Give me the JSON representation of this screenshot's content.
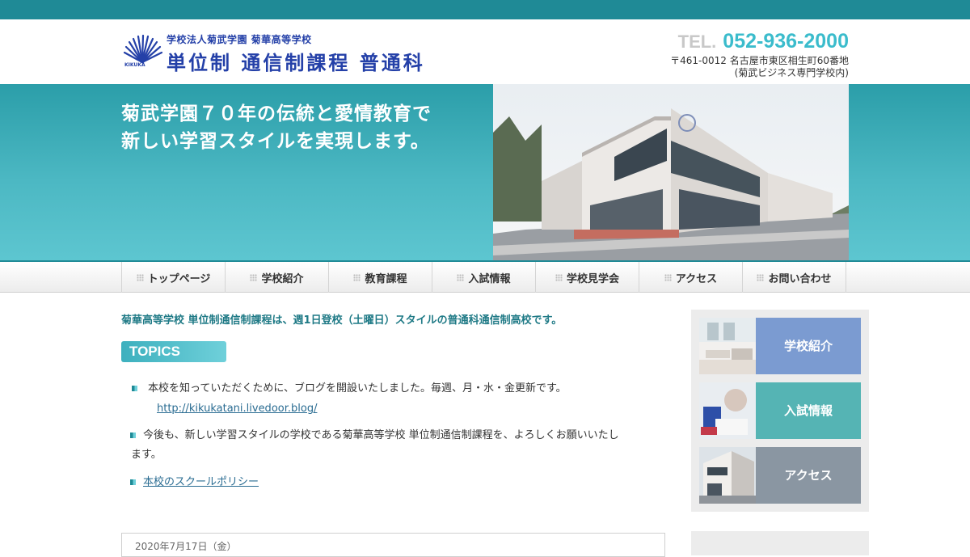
{
  "header": {
    "logo_sub": "学校法人菊武学園 菊華高等学校",
    "logo_main": "単位制 通信制課程 普通科",
    "logo_mark": "KIKUKA",
    "tel_label": "TEL.",
    "tel_number": "052-936-2000",
    "address": "〒461-0012 名古屋市東区相生町60番地",
    "address_note": "(菊武ビジネス専門学校内)"
  },
  "hero": {
    "line1": "菊武学園７０年の伝統と愛情教育で",
    "line2": "新しい学習スタイルを実現します。"
  },
  "nav": {
    "items": [
      {
        "label": "トップページ"
      },
      {
        "label": "学校紹介"
      },
      {
        "label": "教育課程"
      },
      {
        "label": "入試情報"
      },
      {
        "label": "学校見学会"
      },
      {
        "label": "アクセス"
      },
      {
        "label": "お問い合わせ"
      }
    ]
  },
  "main": {
    "intro": "菊華高等学校 単位制通信制課程は、週1日登校（土曜日）スタイルの普通科通信制高校です。",
    "topics_heading": "TOPICS",
    "topics": {
      "item1": "本校を知っていただくために、ブログを開設いたしました。毎週、月・水・金更新です。",
      "item1_link": "http://kikukatani.livedoor.blog/",
      "item2_line1": "今後も、新しい学習スタイルの学校である菊華高等学校 単位制通信制課程を、よろしくお願いいたし",
      "item2_line2": "ます。",
      "item3_link": "本校のスクールポリシー"
    },
    "news_date": "2020年7月17日（金）"
  },
  "sidebar": {
    "cards": [
      {
        "label": "学校紹介",
        "color": "#7b9bd1"
      },
      {
        "label": "入試情報",
        "color": "#55b4b4"
      },
      {
        "label": "アクセス",
        "color": "#8a96a2"
      }
    ]
  },
  "colors": {
    "accent": "#1f8a96",
    "hero_light": "#5dc6d0",
    "logo_blue": "#2440a8",
    "tel_cyan": "#3bbccc"
  }
}
